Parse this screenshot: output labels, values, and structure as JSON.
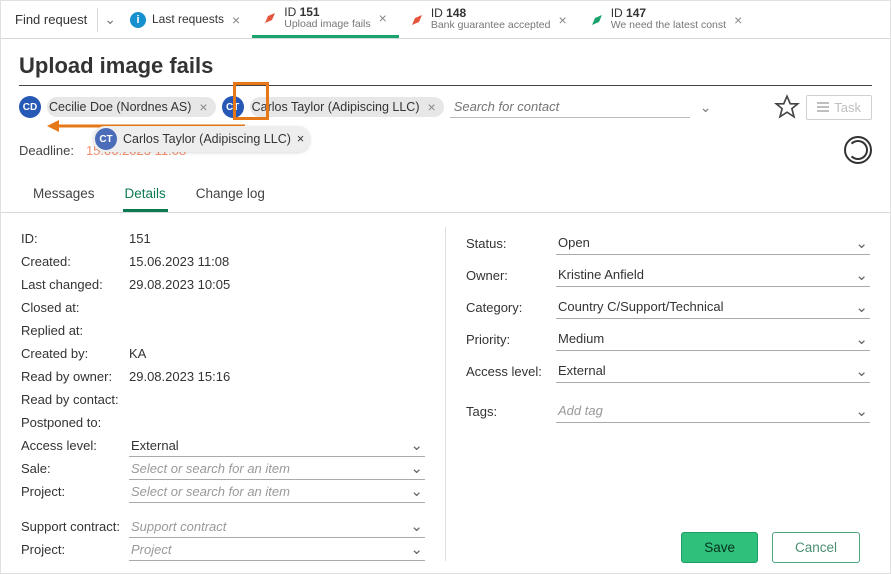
{
  "tabbar": {
    "find_label": "Find request",
    "tabs": [
      {
        "icon": "info",
        "title": "Last requests",
        "sub": "",
        "close": true,
        "active": false
      },
      {
        "icon": "push-red",
        "title_prefix": "ID",
        "title_id": "151",
        "sub": "Upload image fails",
        "close": true,
        "active": true
      },
      {
        "icon": "push-red",
        "title_prefix": "ID",
        "title_id": "148",
        "sub": "Bank guarantee accepted",
        "close": true,
        "active": false
      },
      {
        "icon": "push-green",
        "title_prefix": "ID",
        "title_id": "147",
        "sub": "We need the latest const",
        "close": true,
        "active": false
      }
    ]
  },
  "page": {
    "title": "Upload image fails"
  },
  "contacts": {
    "chips": [
      {
        "initials": "CD",
        "color": "#2658b5",
        "label": "Cecilie Doe (Nordnes AS)"
      },
      {
        "initials": "CT",
        "color": "#2658b5",
        "label": "Carlos Taylor (Adipiscing LLC)"
      }
    ],
    "search_placeholder": "Search for contact"
  },
  "task_btn": "Task",
  "floating_contact": {
    "initials": "CT",
    "color": "#4b6db9",
    "label": "Carlos Taylor (Adipiscing LLC)"
  },
  "deadline": {
    "label": "Deadline:",
    "value": "15.06.2023 11:08"
  },
  "maintabs": [
    "Messages",
    "Details",
    "Change log"
  ],
  "details": {
    "id": {
      "k": "ID:",
      "v": "151"
    },
    "created": {
      "k": "Created:",
      "v": "15.06.2023 11:08"
    },
    "last_changed": {
      "k": "Last changed:",
      "v": "29.08.2023 10:05"
    },
    "closed_at": {
      "k": "Closed at:",
      "v": ""
    },
    "replied_at": {
      "k": "Replied at:",
      "v": ""
    },
    "created_by": {
      "k": "Created by:",
      "v": "KA"
    },
    "read_by_owner": {
      "k": "Read by owner:",
      "v": "29.08.2023 15:16"
    },
    "read_by_contact": {
      "k": "Read by contact:",
      "v": ""
    },
    "postponed_to": {
      "k": "Postponed to:",
      "v": ""
    },
    "access_level": {
      "k": "Access level:",
      "v": "External"
    },
    "sale": {
      "k": "Sale:",
      "placeholder": "Select or search for an item"
    },
    "project1": {
      "k": "Project:",
      "placeholder": "Select or search for an item"
    },
    "support_contract": {
      "k": "Support contract:",
      "placeholder": "Support contract"
    },
    "project2": {
      "k": "Project:",
      "placeholder": "Project"
    }
  },
  "right": {
    "status": {
      "k": "Status:",
      "v": "Open"
    },
    "owner": {
      "k": "Owner:",
      "v": "Kristine Anfield"
    },
    "category": {
      "k": "Category:",
      "v": "Country C/Support/Technical"
    },
    "priority": {
      "k": "Priority:",
      "v": "Medium"
    },
    "access_level": {
      "k": "Access level:",
      "v": "External"
    },
    "tags": {
      "k": "Tags:",
      "placeholder": "Add tag"
    }
  },
  "buttons": {
    "save": "Save",
    "cancel": "Cancel"
  }
}
